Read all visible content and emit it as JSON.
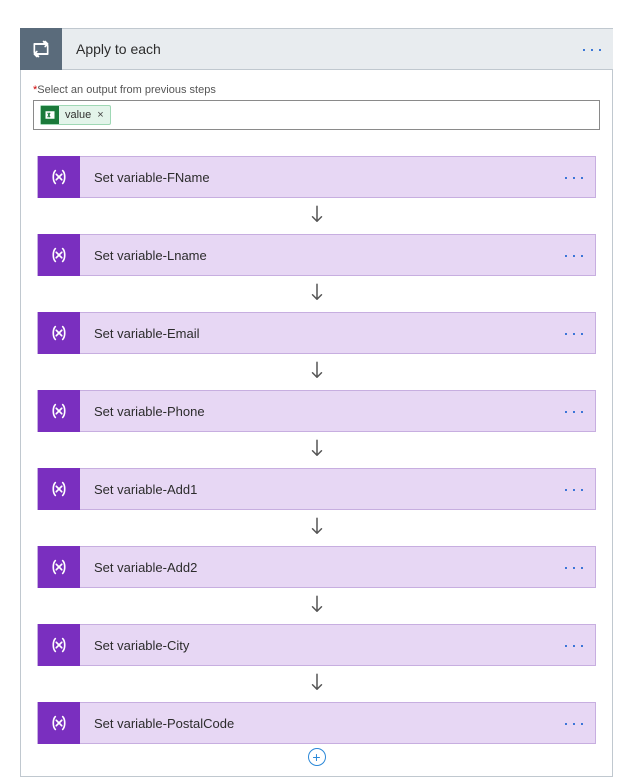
{
  "header": {
    "title": "Apply to each"
  },
  "selector": {
    "label": "Select an output from previous steps",
    "token_label": "value"
  },
  "steps": [
    {
      "label": "Set variable-FName"
    },
    {
      "label": "Set variable-Lname"
    },
    {
      "label": "Set variable-Email"
    },
    {
      "label": "Set variable-Phone"
    },
    {
      "label": "Set variable-Add1"
    },
    {
      "label": "Set variable-Add2"
    },
    {
      "label": "Set variable-City"
    },
    {
      "label": "Set variable-PostalCode"
    }
  ]
}
